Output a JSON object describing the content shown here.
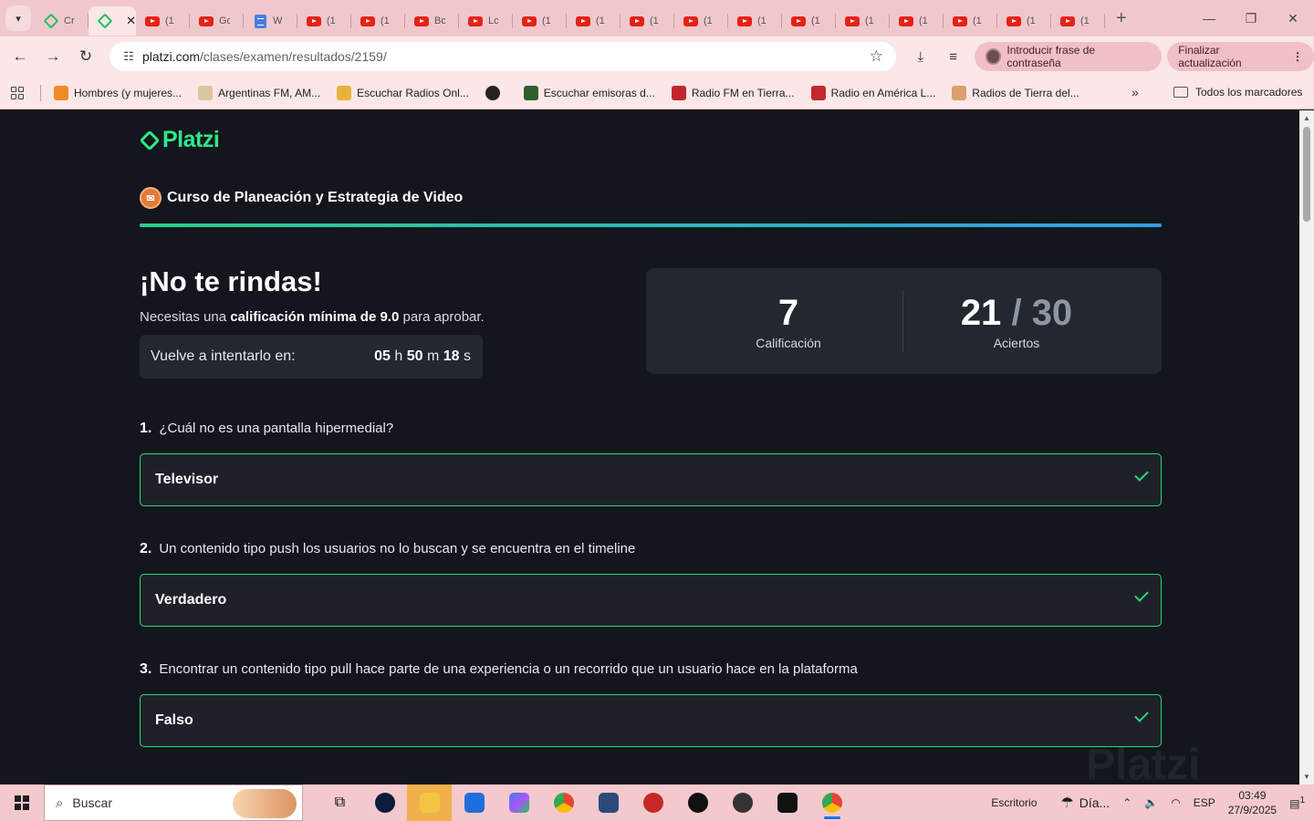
{
  "browser": {
    "tabs": [
      {
        "icon": "platzi",
        "title": "Cr"
      },
      {
        "icon": "platzi",
        "title": "",
        "active": true
      },
      {
        "icon": "youtube",
        "title": "(1"
      },
      {
        "icon": "youtube",
        "title": "Gc"
      },
      {
        "icon": "docs",
        "title": "W"
      },
      {
        "icon": "youtube",
        "title": "(1"
      },
      {
        "icon": "youtube",
        "title": "(1"
      },
      {
        "icon": "youtube",
        "title": "Bc"
      },
      {
        "icon": "youtube",
        "title": "Lc"
      },
      {
        "icon": "youtube",
        "title": "(1"
      },
      {
        "icon": "youtube",
        "title": "(1"
      },
      {
        "icon": "youtube",
        "title": "(1"
      },
      {
        "icon": "youtube",
        "title": "(1"
      },
      {
        "icon": "youtube",
        "title": "(1"
      },
      {
        "icon": "youtube",
        "title": "(1"
      },
      {
        "icon": "youtube",
        "title": "(1"
      },
      {
        "icon": "youtube",
        "title": "(1"
      },
      {
        "icon": "youtube",
        "title": "(1"
      },
      {
        "icon": "youtube",
        "title": "(1"
      },
      {
        "icon": "youtube",
        "title": "(1"
      }
    ],
    "url_host": "platzi.com",
    "url_path": "/clases/examen/resultados/2159/",
    "passphrase_label": "Introducir frase de contraseña",
    "update_label": "Finalizar actualización",
    "bookmarks": [
      {
        "label": "Hombres (y mujeres...",
        "color": "#f08a24"
      },
      {
        "label": "Argentinas FM, AM...",
        "color": "#d9c7a0"
      },
      {
        "label": "Escuchar Radios Onl...",
        "color": "#e8b23a"
      },
      {
        "label": "",
        "color": "#222"
      },
      {
        "label": "Escuchar emisoras d...",
        "color": "#2c5f2c"
      },
      {
        "label": "Radio FM en Tierra...",
        "color": "#c0282d"
      },
      {
        "label": "Radio en América L...",
        "color": "#c0282d"
      },
      {
        "label": "Radios de Tierra del...",
        "color": "#d9a070"
      }
    ],
    "all_bookmarks": "Todos los marcadores"
  },
  "page": {
    "logo": "Platzi",
    "course_title": "Curso de Planeación y Estrategia de Video",
    "result_title": "¡No te rindas!",
    "requirement_prefix": "Necesitas una ",
    "requirement_bold": "calificación mínima de 9.0",
    "requirement_suffix": " para aprobar.",
    "retry_label": "Vuelve a intentarlo en:",
    "timer": {
      "h": "05",
      "h_unit": "h",
      "m": "50",
      "m_unit": "m",
      "s": "18",
      "s_unit": "s"
    },
    "score": {
      "value": "7",
      "label": "Calificación"
    },
    "hits": {
      "correct": "21",
      "separator": "/",
      "total": "30",
      "label": "Aciertos"
    },
    "questions": [
      {
        "number": "1.",
        "text": "¿Cuál no es una pantalla hipermedial?",
        "answer": "Televisor"
      },
      {
        "number": "2.",
        "text": "Un contenido tipo push los usuarios no lo buscan y se encuentra en el timeline",
        "answer": "Verdadero"
      },
      {
        "number": "3.",
        "text": "Encontrar un contenido tipo pull hace parte de una experiencia o un recorrido que un usuario hace en la plataforma",
        "answer": "Falso"
      }
    ],
    "watermark": "Platzi"
  },
  "taskbar": {
    "search_placeholder": "Buscar",
    "desktop_label": "Escritorio",
    "weather_label": "Día...",
    "language": "ESP",
    "time": "03:49",
    "date": "27/9/2025",
    "notifications": "1"
  },
  "colors": {
    "accent": "#2fd57a",
    "background": "#13161c",
    "card": "#232730"
  }
}
